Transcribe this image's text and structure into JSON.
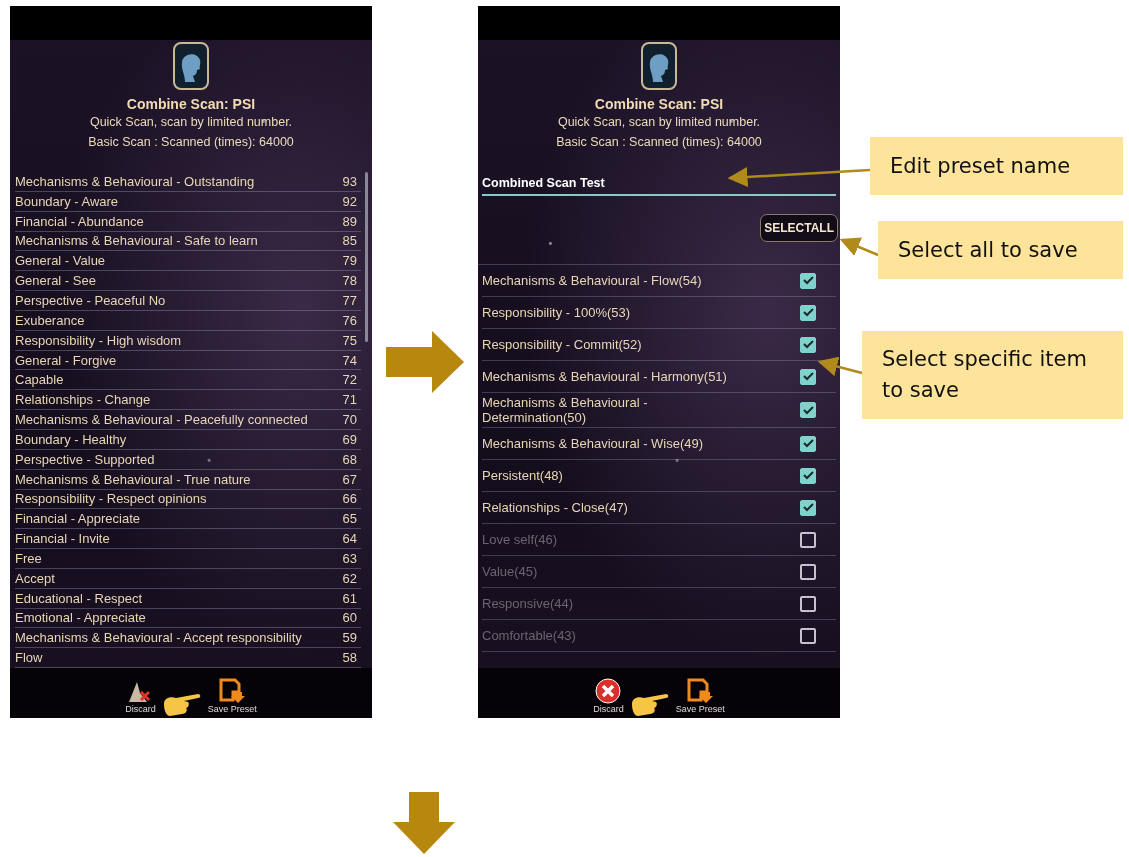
{
  "screens": [
    {
      "kind": "results",
      "title": "Combine Scan: PSI",
      "subtitle_lines": [
        "Quick Scan, scan by limited number.",
        "Basic Scan : Scanned (times): 64000"
      ],
      "results": [
        {
          "name": "Mechanisms & Behavioural - Outstanding",
          "score": "93"
        },
        {
          "name": "Boundary - Aware",
          "score": "92"
        },
        {
          "name": "Financial - Abundance",
          "score": "89"
        },
        {
          "name": "Mechanisms & Behavioural - Safe to learn",
          "score": "85"
        },
        {
          "name": "General - Value",
          "score": "79"
        },
        {
          "name": "General - See",
          "score": "78"
        },
        {
          "name": "Perspective - Peaceful No",
          "score": "77"
        },
        {
          "name": "Exuberance",
          "score": "76"
        },
        {
          "name": "Responsibility - High wisdom",
          "score": "75"
        },
        {
          "name": "General - Forgive",
          "score": "74"
        },
        {
          "name": "Capable",
          "score": "72"
        },
        {
          "name": "Relationships - Change",
          "score": "71"
        },
        {
          "name": "Mechanisms & Behavioural - Peacefully connected",
          "score": "70"
        },
        {
          "name": "Boundary - Healthy",
          "score": "69"
        },
        {
          "name": "Perspective - Supported",
          "score": "68"
        },
        {
          "name": "Mechanisms & Behavioural - True nature",
          "score": "67"
        },
        {
          "name": "Responsibility - Respect opinions",
          "score": "66"
        },
        {
          "name": "Financial - Appreciate",
          "score": "65"
        },
        {
          "name": "Financial - Invite",
          "score": "64"
        },
        {
          "name": "Free",
          "score": "63"
        },
        {
          "name": "Accept",
          "score": "62"
        },
        {
          "name": "Educational - Respect",
          "score": "61"
        },
        {
          "name": "Emotional - Appreciate",
          "score": "60"
        },
        {
          "name": "Mechanisms & Behavioural - Accept responsibility",
          "score": "59"
        },
        {
          "name": "Flow",
          "score": "58"
        }
      ],
      "actions": [
        {
          "kind": "discard",
          "label": "Discard"
        },
        {
          "kind": "save",
          "label": "Save Preset"
        }
      ]
    },
    {
      "kind": "selection",
      "title": "Combine Scan: PSI",
      "subtitle_lines": [
        "Quick Scan, scan by limited number.",
        "Basic Scan : Scanned (times): 64000"
      ],
      "preset_name": "Combined Scan Test",
      "select_all_label": "SELECTALL",
      "items": [
        {
          "label": "Mechanisms & Behavioural - Flow(54)",
          "checked": true
        },
        {
          "label": "Responsibility - 100%(53)",
          "checked": true
        },
        {
          "label": "Responsibility - Commit(52)",
          "checked": true
        },
        {
          "label": "Mechanisms & Behavioural - Harmony(51)",
          "checked": true
        },
        {
          "label": "Mechanisms & Behavioural - Determination(50)",
          "checked": true
        },
        {
          "label": "Mechanisms & Behavioural - Wise(49)",
          "checked": true
        },
        {
          "label": "Persistent(48)",
          "checked": true
        },
        {
          "label": "Relationships - Close(47)",
          "checked": true
        },
        {
          "label": "Love self(46)",
          "checked": false
        },
        {
          "label": "Value(45)",
          "checked": false
        },
        {
          "label": "Responsive(44)",
          "checked": false
        },
        {
          "label": "Comfortable(43)",
          "checked": false
        }
      ],
      "actions": [
        {
          "kind": "discard",
          "label": "Discard"
        },
        {
          "kind": "save",
          "label": "Save Preset"
        }
      ]
    }
  ],
  "callouts": [
    {
      "text": "Edit preset name"
    },
    {
      "text": "Select all to save"
    },
    {
      "text": "Select specific item to save"
    }
  ]
}
